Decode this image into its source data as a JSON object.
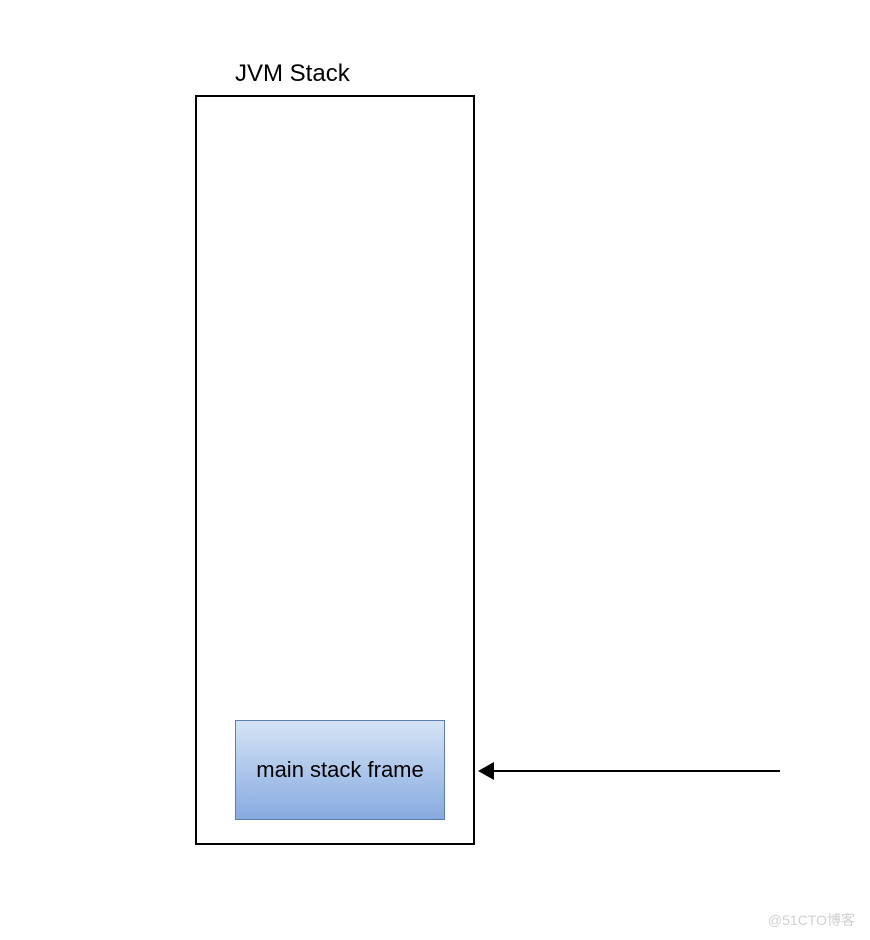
{
  "diagram": {
    "title": "JVM Stack",
    "frames": [
      {
        "label": "main stack frame"
      }
    ]
  },
  "watermark": "@51CTO博客"
}
